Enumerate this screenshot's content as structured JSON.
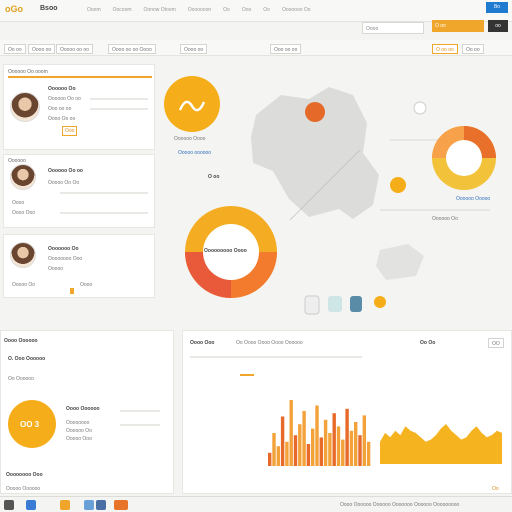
{
  "app": {
    "logo": "oGo",
    "brand": "Bsoo",
    "nav": [
      "Ooom",
      "Oocoom",
      "Oonow Otoem",
      "Ooooooon",
      "Oo",
      "Ooo",
      "Oo",
      "Ooooooo Oo"
    ],
    "top_search_placeholder": "Oooo",
    "top_orange_label": "O oo",
    "top_blue_label": "Bo",
    "top_dark_label": "oo"
  },
  "filters": {
    "chips": [
      "Oo oo",
      "Oooo oo",
      "Ooooo oo oo",
      "Oooo oo oo Oooo",
      "Oooo oo",
      "Ooo oo oo",
      "O oo oo",
      "Oo oo"
    ]
  },
  "profiles": [
    {
      "title": "Oooooo Oo ooom",
      "name": "Oooooo Oo",
      "lines": [
        "Oooooo Oo oo",
        "Ooo oo oo",
        "Oooo Oo oo"
      ],
      "badge": "Ooo"
    },
    {
      "title": "Oooooo",
      "name": "Oooooo Oo oo",
      "lines": [
        "Ooooo Oo Oo",
        "Oooo",
        "Oooo Ooo"
      ],
      "badge": ""
    },
    {
      "title": "Ooooooo Oo",
      "name": "Oooooooo Ooo",
      "lines": [
        "Ooooo",
        "Ooooo Oo",
        "Oooo"
      ],
      "badge": ""
    }
  ],
  "center": {
    "label_small": "Oooooo Oooo",
    "label_blue": "Ooooo oooooo",
    "map_button": "O oo",
    "donut_label": "Ooooooooo Oooo"
  },
  "right": {
    "legend_title": "Oooooo Oo",
    "legend_link": "Oooooo Ooooo"
  },
  "bottom": {
    "panel_title": "Oooo Oooooo",
    "sub_title": "O. Ooo Oooooo",
    "sub_label": "Oo Oooooo",
    "gauge_value": "OO 3",
    "gauge_title": "Oooo Oooooo",
    "gauge_lines": [
      "Oooooooo",
      "Oooooo Oo",
      "Ooooo Ooo"
    ],
    "bottom_left_title": "Oooooooo Ooo",
    "bottom_left_sub": "Ooooo Oooooo",
    "chart_panel_title": "Oooo Ooo",
    "chart_header": "Oo Oooo Oooo Oooo Oooooo",
    "chart_right_header": "Oo Oo",
    "chart_tab": "OO",
    "status_text": "Oooo Oooooo Oooooo Ooooooo Oooooo Ooooooooo",
    "status_badge": "Oo"
  },
  "chart_data": [
    {
      "type": "bar",
      "title": "",
      "categories": [],
      "values": [
        12,
        30,
        18,
        45,
        22,
        60,
        28,
        38,
        50,
        20,
        34,
        55,
        26,
        42,
        30,
        48,
        36,
        24,
        52,
        32,
        40,
        28,
        46,
        22
      ]
    },
    {
      "type": "area",
      "title": "",
      "x": [],
      "values": [
        20,
        28,
        24,
        30,
        26,
        34,
        30,
        28,
        24,
        20,
        22,
        26,
        32,
        36,
        30,
        26,
        22,
        24,
        30,
        34,
        28,
        24,
        26,
        30,
        28
      ]
    }
  ]
}
